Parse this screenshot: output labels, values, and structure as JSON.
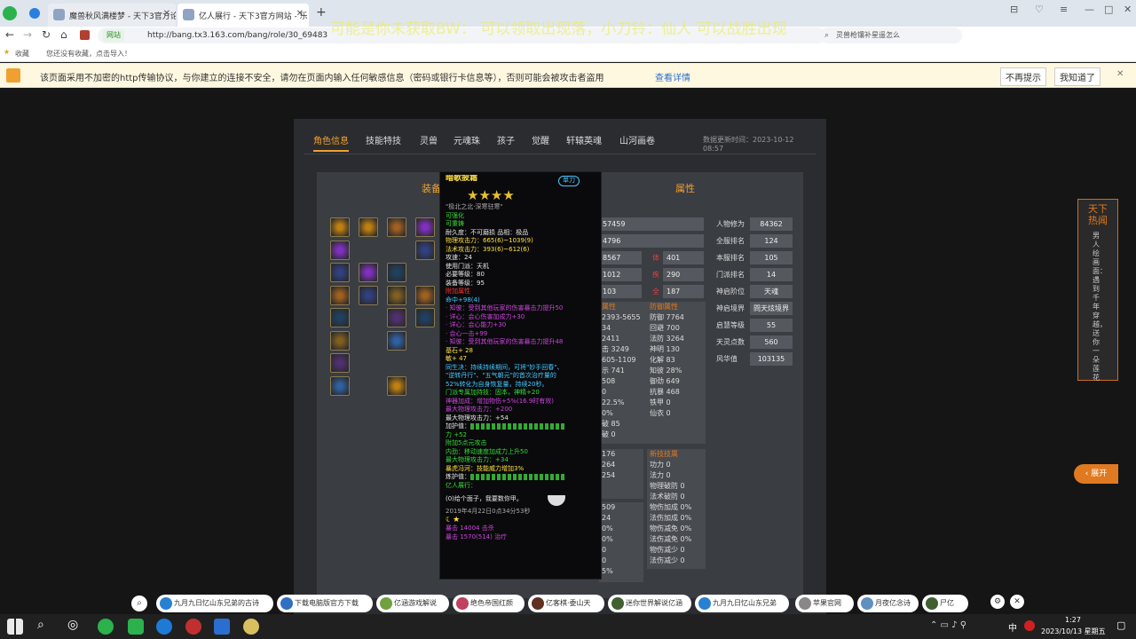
{
  "browser": {
    "tabs": [
      {
        "label": "魔兽秋风满楼梦 - 天下3官方论"
      },
      {
        "label": "亿人展行 - 天下3官方网站 - 乐"
      }
    ],
    "new_tab": "+",
    "url": "http://bang.tx3.163.com/bang/role/30_69483",
    "secure_label": "网站",
    "search_placeholder": "灵兽枪镶补星遥怎么",
    "overlay_text": "可能是你未获取BW：        可以领取出现落，小刀铃：仙人        可以战胜出现",
    "bookmarks": {
      "fav": "收藏",
      "hint": "您还没有收藏，点击导入！"
    },
    "warning": {
      "text": "该页面采用不加密的http传输协议，与你建立的连接不安全，请勿在页面内输入任何敏感信息（密码或银行卡信息等），否则可能会被攻击者盗用",
      "link": "查看详情",
      "btn_no": "不再提示",
      "btn_ok": "我知道了"
    }
  },
  "nav": {
    "items": [
      "角色信息",
      "技能特技",
      "灵兽",
      "元魂珠",
      "孩子",
      "觉醒",
      "轩辕英魂",
      "山河画卷"
    ],
    "updated": "数据更新时间：2023-10-12 08:57"
  },
  "sections": {
    "equip": "装备",
    "attr": "属性"
  },
  "right_stats": [
    {
      "label": "人物修为",
      "value": "84362"
    },
    {
      "label": "全服排名",
      "value": "124"
    },
    {
      "label": "本服排名",
      "value": "105"
    },
    {
      "label": "门派排名",
      "value": "14"
    },
    {
      "label": "神启阶位",
      "value": "天魂"
    },
    {
      "label": "神启境界",
      "value": "問天炫境界"
    },
    {
      "label": "启慧等级",
      "value": "55"
    },
    {
      "label": "天灵点数",
      "value": "560"
    },
    {
      "label": "风华值",
      "value": "103135"
    }
  ],
  "mid_stats": [
    {
      "value": "57459"
    },
    {
      "value": "4796"
    },
    {
      "label": "",
      "value": "8567",
      "l2": "体",
      "v2": "401"
    },
    {
      "label": "",
      "value": "1012",
      "l2": "疾",
      "v2": "290"
    },
    {
      "label": "",
      "value": "103",
      "l2": "全",
      "v2": "187"
    }
  ],
  "col_left": [
    "属性",
    "2393-5655",
    "34",
    "2411",
    "击 3249",
    "605-1109",
    "示 741",
    "508",
    "0",
    "22.5%",
    "0%",
    "破 85",
    "破 0"
  ],
  "col_right": [
    "防御属性",
    "防御 7764",
    "回避 700",
    "法防 3264",
    "神明 130",
    "化解 83",
    "知彼 28%",
    "御劲 649",
    "抗暴 468",
    "铁甲 0",
    "仙衣 0"
  ],
  "col_left2": [
    "176",
    "264",
    "254"
  ],
  "col_right2": [
    "新技技属",
    "功力 0",
    "法力 0",
    "物理破防 0",
    "法术破防 0",
    "物伤加成 0%",
    "法伤加成 0%",
    "物伤减免 0%",
    "法伤减免 0%",
    "物伤减少 0",
    "法伤减少 0"
  ],
  "col_left3": [
    "509",
    "24",
    "0%",
    "0%",
    "0",
    "0",
    "5%"
  ],
  "tooltip": {
    "name": "暗歌披霜",
    "type": "单刀",
    "rank": "\"极北之北·深寒驻寒\"",
    "lines": [
      {
        "t": "可强化",
        "c": "g"
      },
      {
        "t": "可重铸",
        "c": "g"
      },
      {
        "t": "耐久度：不可磨损  品相：极品",
        "c": "w"
      },
      {
        "t": "物理攻击力：665(6)~1039(9)",
        "c": "y"
      },
      {
        "t": "法术攻击力：393(6)~612(6)",
        "c": "y"
      },
      {
        "t": "攻速：24",
        "c": "w"
      },
      {
        "t": "使用门派：天机",
        "c": "w"
      },
      {
        "t": "必要等级：80",
        "c": "w"
      },
      {
        "t": "装备等级：95",
        "c": "w"
      },
      {
        "t": "附加属性",
        "c": "r"
      },
      {
        "t": "命中+98(4)",
        "c": "c"
      },
      {
        "t": "· 知彼：受到其他玩家的伤害暴击力提升50",
        "c": "p"
      },
      {
        "t": "· 详心：会心伤害加成力+30",
        "c": "p"
      },
      {
        "t": "· 详心：会心能力+30",
        "c": "p"
      },
      {
        "t": "· 会心一击+99",
        "c": "p"
      },
      {
        "t": "· 知彼：受到其他玩家的伤害暴击力提升48",
        "c": "p"
      },
      {
        "t": "基石+ 28",
        "c": "y"
      },
      {
        "t": "敏+ 47",
        "c": "y"
      },
      {
        "t": "同生决：持续持续期间，可将\"妙手回春\"、",
        "c": "c"
      },
      {
        "t": "\"逆转丹行\"、\"五气朝元\"的首次治疗量的",
        "c": "c"
      },
      {
        "t": "52%转化为自身恢复量，持续20秒。",
        "c": "c"
      },
      {
        "t": "门派专属加持技：固本，神精+20",
        "c": "g"
      },
      {
        "t": "神器加成：增加物伤+5%(16.9时有效)",
        "c": "p"
      },
      {
        "t": "最大物理攻击力：+200",
        "c": "p"
      },
      {
        "t": "最大物理攻击力：+54",
        "c": "w"
      },
      {
        "t": "加护值：",
        "c": "w",
        "bars": true
      },
      {
        "t": "力 +52",
        "c": "g"
      },
      {
        "t": "附加5点元攻击",
        "c": "g"
      },
      {
        "t": "内劲：移动速度加成力上升50",
        "c": "g"
      },
      {
        "t": "最大物理攻击力：+34",
        "c": "g"
      },
      {
        "t": "暴虎冯河：技能威力增加3%",
        "c": "y"
      },
      {
        "t": "炼护值：",
        "c": "w",
        "bars": true
      },
      {
        "t": "亿人展行：",
        "c": "g"
      }
    ],
    "owner_line": "(0)给个面子，我要数你甲。",
    "date": "2019年4月22日0点34分53秒",
    "score1": "暴击  14004  击杀",
    "score2": "暴击  1570(514)  治疗"
  },
  "float": {
    "title": "天下热闻",
    "body": "男人绘画面：遇到千年穿越，送你一朵莲花"
  },
  "expand": "展开",
  "quicklinks": [
    "九月九日忆山东兄弟的古诗",
    "下载电脑版官方下载",
    "亿涵游戏解说",
    "绝色帝国红颜",
    "亿客棋·委山天",
    "迷你世界解说亿涵",
    "九月九日忆山东兄弟",
    "苹果官网",
    "月夜亿念诗",
    "尸亿"
  ],
  "clock": {
    "time": "1:27",
    "date": "2023/10/13 星期五"
  },
  "ime": "中"
}
